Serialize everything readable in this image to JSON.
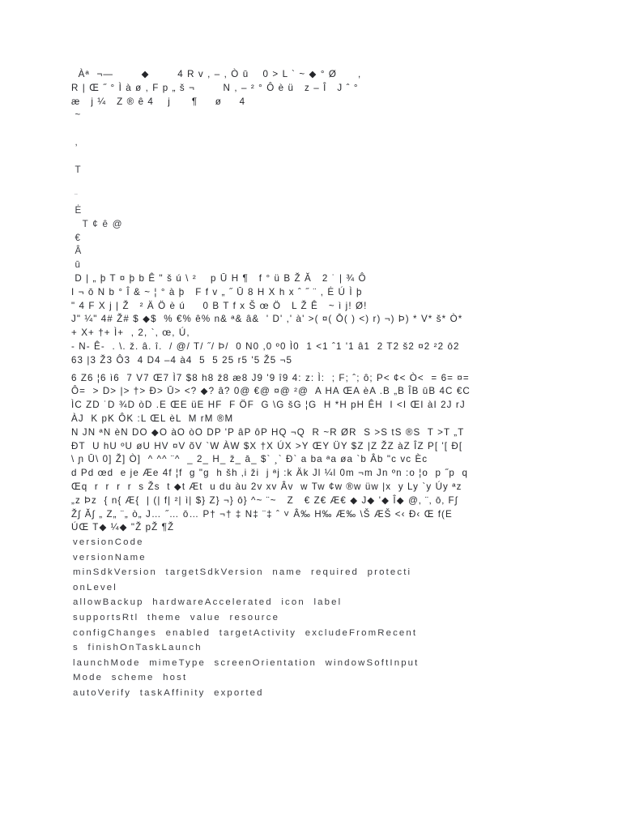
{
  "document": {
    "page_background": "#ffffff",
    "ink_color": "#2a2a2a",
    "kind": "binary-text-dump",
    "binary_dump_lines": [
      "  Àª  ¬—        ◆        4 R v , – , Ò ū    0 > L ` ~ ◆ ° Ø      ,",
      "R | Œ ˝ ° Ì à ø , F p „ š ¬        N , – ² ° Ô è ü   z – Î   J ˆ °",
      "æ   j ¼   Z ® ê 4    j      ¶     ø     4",
      " ~",
      "",
      " ,",
      "",
      " T",
      "",
      " ¨",
      " Ė",
      "   T ¢ ê @",
      " €",
      " Â",
      " ū",
      " D | „ þ T ¤ þ b Ê \" š ú \\ ²    p Ū H ¶   f ° ü B Ž Ă   2 ˙ | ¾ Ô",
      "I ¬ ō N b ° Î & ~ ¦ ° à þ   F f v „ ˝ Ū 8 H X h x ˆ ˝ ¨ , Ė Ú Ì þ",
      "\" 4 F X j | Ž   ² Ä Ö è ú     0 B T f x Š œ Ö   L Ž Ê   ~ ì j! Ø!",
      "J\" ¼\" 4# Ž# $ ◆$  % €% ê% n& ª& â&  ' D' ,' à' >( ¤( Ō( ) <) r) ¬) Þ) * V* š* Ò*",
      "+ X+ †+ Ì+  , 2, `, œ, Ú,",
      "- N- Ê-  . \\. ž. â. î.  / @/ T/ ˝/ Þ/  0 N0 ,0 º0 Ì0  1 <1 ˆ1 '1 â1  2 T2 š2 ¤2 ²2 ō2",
      "63 |3 Ž3 Ô3  4 D4 –4 à4  5  5 25 r5 '5 Ž5 ¬5",
      "6 Z6 ¦6 ì6  7 V7 Œ7 Ì7 $8 h8 ž8 æ8 J9 '9 î9 4: z: Ì:  ; F; ˆ; ô; P< ¢< Ò<  = 6= ¤=",
      "Ô=  > D> |> †> Ð> Ū> <? ◆? â? 0@ €@ ¤@ ²@  A HA ŒA èA .B „B ÎB ūB 4C €C",
      "ÌC ZD ˙D ¾D òD .E ŒE üE HF  F ÖF  G \\G šG ¦G  H *H pH ÊH  I <I ŒI àI 2J rJ",
      "ÀJ  K pK ÔK :L ŒL èL  M rM ®M",
      "N JN ªN èN DO ◆O àO òO DP 'P âP ôP HQ ¬Q  R ~R ØR  S >S tS ®S  T >T „T",
      "ÐT  U hU ºU øU HV ¤V õV `W ÀW $X †X ÚX >Y ŒY ÜY $Z |Z ŽZ àZ ÎZ P[ '[ Ð[",
      "\\ ɲ Ū\\ 0] Ž] Ò]  ^ ^^ ¨^  _ 2_ H_ ž_ ā_ $` ¸` Ð` a ba ªa øa `b Âb \"c vc Èc",
      "d Pd œd  e je Æe 4f ¦f  g \"g  h šh ‚i ži  j ªj :k Äk Jl ¼l 0m ¬m Jn ºn :o ¦o  p ˝p  q",
      "Œq  r  r  r  r  s Žs  t ◆t Æt  u du àu 2v xv Âv  w Tw ¢w ®w üw |x  y Ly `y Úy ªz",
      "„z Þz  { n{ Æ{  | (| f| ²| ì| $} Z} ¬} ō} ^~ ¨~   Z   € Z€ Æ€ ◆ J◆ '◆ Î◆ @‚ ¨‚ ō‚ F∫",
      "Ž∫ Ă∫ „ Z„ ¨„ ò„ J… ˝… ō… P† ¬† ‡ N‡ ¨‡ ˆ ˅ Â‰ H‰ Æ‰ \\Š ÆŠ <‹ Ð‹ Œ f(E",
      "ÚŒ T◆ ¼◆ \"Ž pŽ ¶Ž"
    ],
    "manifest_attribute_lines": [
      "versionCode",
      "versionName",
      "minSdkVersion  targetSdkVersion  name  required  protecti",
      "onLevel",
      "allowBackup  hardwareAccelerated  icon  label",
      "supportsRtl  theme  value  resource",
      "configChanges  enabled  targetActivity  excludeFromRecent",
      "s  finishOnTaskLaunch",
      "launchMode  mimeType  screenOrientation  windowSoftInput",
      "Mode  scheme  host",
      "autoVerify  taskAffinity  exported"
    ]
  }
}
